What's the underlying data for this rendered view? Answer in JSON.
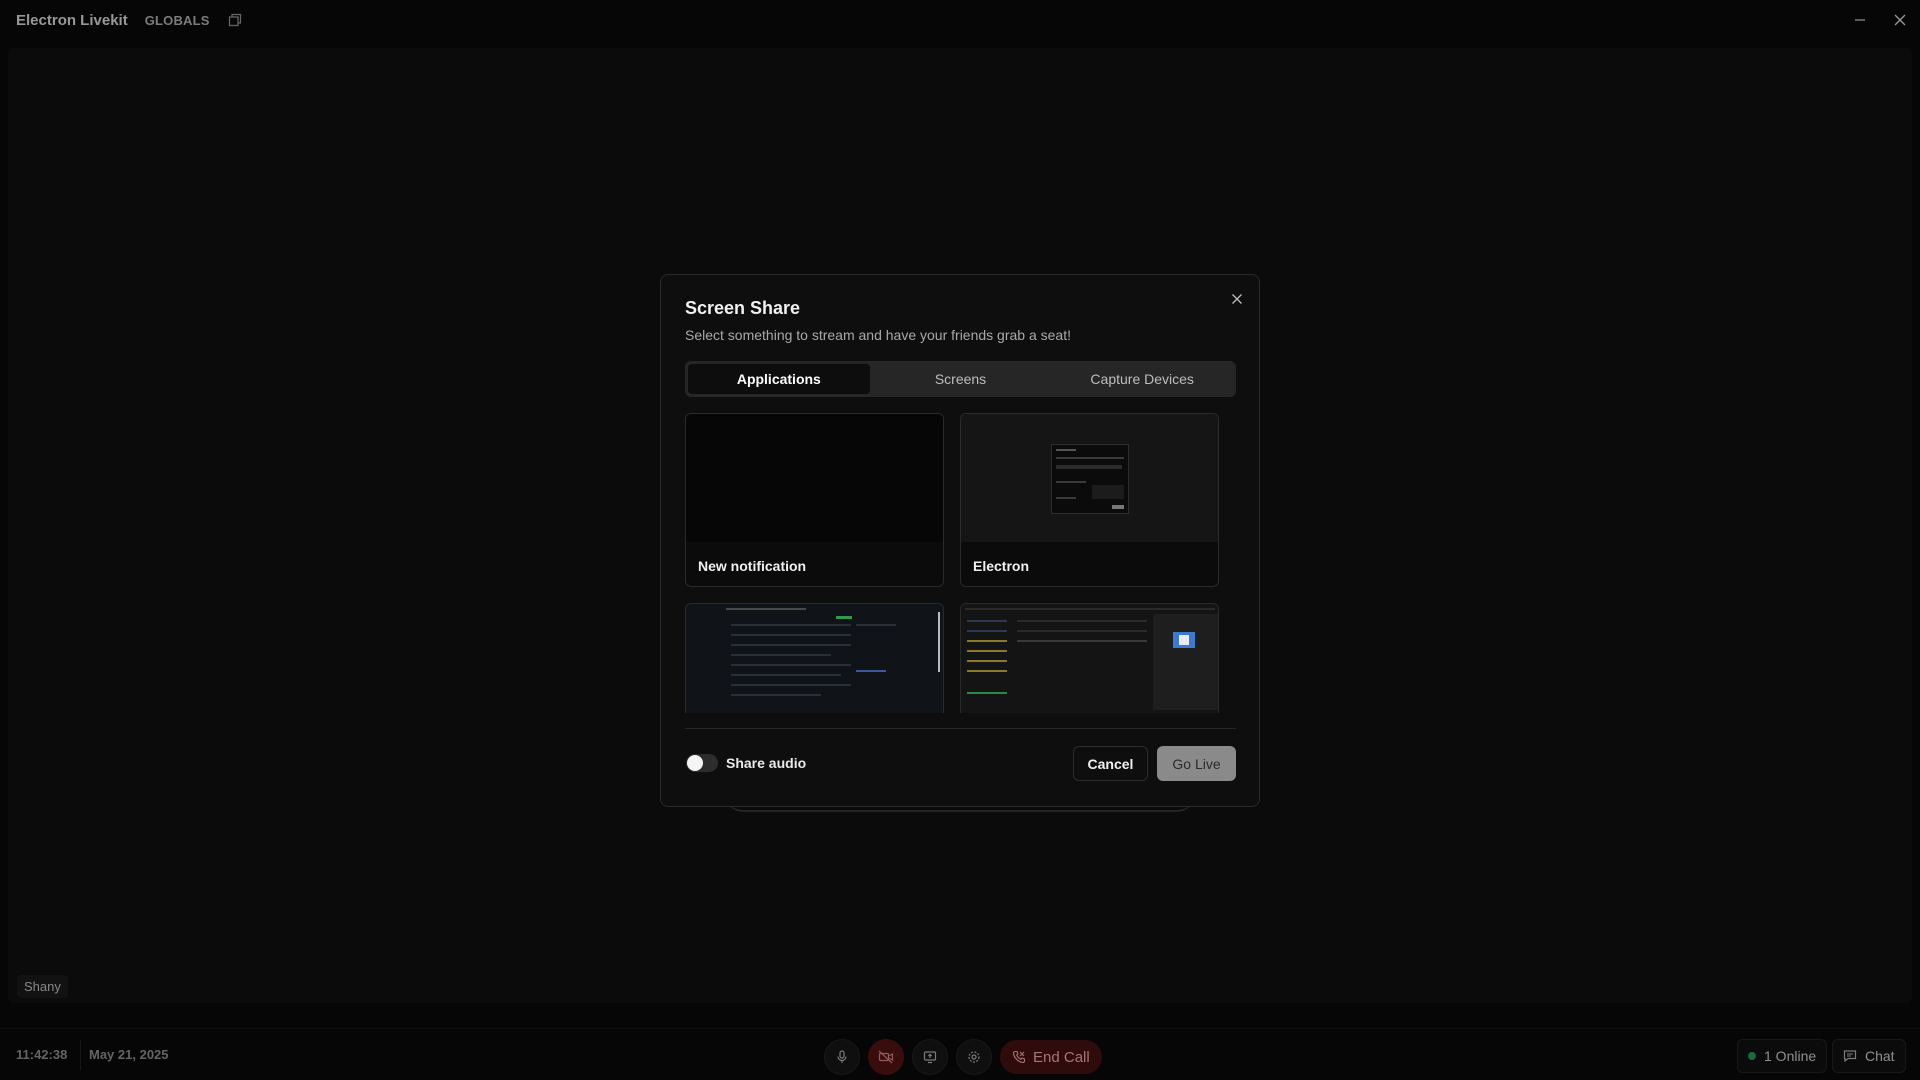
{
  "window": {
    "title": "Electron Livekit",
    "globals_label": "GLOBALS"
  },
  "stage": {
    "participant_name": "Shany"
  },
  "bottom_bar": {
    "time": "11:42:38",
    "date": "May 21, 2025",
    "end_call_label": "End Call",
    "online_label": "1 Online",
    "chat_label": "Chat"
  },
  "modal": {
    "title": "Screen Share",
    "subtitle": "Select something to stream and have your friends grab a seat!",
    "tabs": [
      {
        "label": "Applications",
        "active": true
      },
      {
        "label": "Screens",
        "active": false
      },
      {
        "label": "Capture Devices",
        "active": false
      }
    ],
    "sources": [
      {
        "label": "New notification"
      },
      {
        "label": "Electron"
      },
      {
        "label": ""
      },
      {
        "label": ""
      }
    ],
    "share_audio_label": "Share audio",
    "share_audio_on": false,
    "cancel_label": "Cancel",
    "go_live_label": "Go Live"
  },
  "colors": {
    "background": "#0a0a0a",
    "stage": "#111111",
    "end_call": "#4a1212",
    "online_dot": "#23a559",
    "go_live_disabled": "#8a8a8a"
  }
}
